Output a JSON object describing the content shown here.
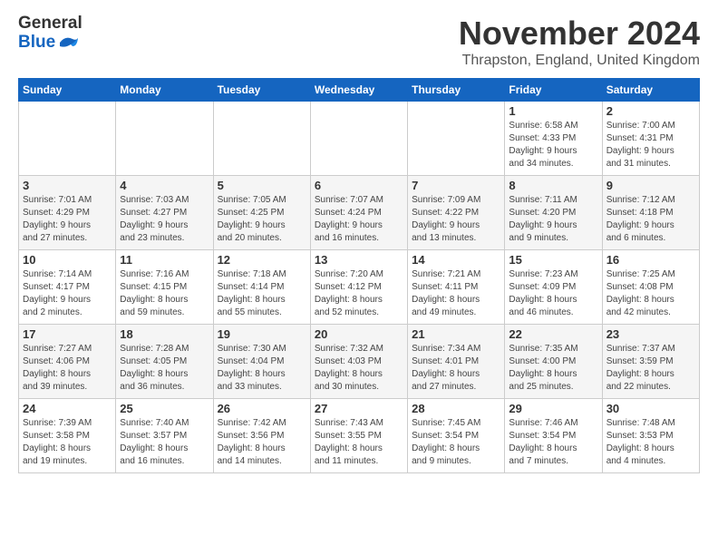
{
  "logo": {
    "line1": "General",
    "line2": "Blue"
  },
  "title": "November 2024",
  "location": "Thrapston, England, United Kingdom",
  "weekdays": [
    "Sunday",
    "Monday",
    "Tuesday",
    "Wednesday",
    "Thursday",
    "Friday",
    "Saturday"
  ],
  "weeks": [
    [
      {
        "day": "",
        "info": ""
      },
      {
        "day": "",
        "info": ""
      },
      {
        "day": "",
        "info": ""
      },
      {
        "day": "",
        "info": ""
      },
      {
        "day": "",
        "info": ""
      },
      {
        "day": "1",
        "info": "Sunrise: 6:58 AM\nSunset: 4:33 PM\nDaylight: 9 hours\nand 34 minutes."
      },
      {
        "day": "2",
        "info": "Sunrise: 7:00 AM\nSunset: 4:31 PM\nDaylight: 9 hours\nand 31 minutes."
      }
    ],
    [
      {
        "day": "3",
        "info": "Sunrise: 7:01 AM\nSunset: 4:29 PM\nDaylight: 9 hours\nand 27 minutes."
      },
      {
        "day": "4",
        "info": "Sunrise: 7:03 AM\nSunset: 4:27 PM\nDaylight: 9 hours\nand 23 minutes."
      },
      {
        "day": "5",
        "info": "Sunrise: 7:05 AM\nSunset: 4:25 PM\nDaylight: 9 hours\nand 20 minutes."
      },
      {
        "day": "6",
        "info": "Sunrise: 7:07 AM\nSunset: 4:24 PM\nDaylight: 9 hours\nand 16 minutes."
      },
      {
        "day": "7",
        "info": "Sunrise: 7:09 AM\nSunset: 4:22 PM\nDaylight: 9 hours\nand 13 minutes."
      },
      {
        "day": "8",
        "info": "Sunrise: 7:11 AM\nSunset: 4:20 PM\nDaylight: 9 hours\nand 9 minutes."
      },
      {
        "day": "9",
        "info": "Sunrise: 7:12 AM\nSunset: 4:18 PM\nDaylight: 9 hours\nand 6 minutes."
      }
    ],
    [
      {
        "day": "10",
        "info": "Sunrise: 7:14 AM\nSunset: 4:17 PM\nDaylight: 9 hours\nand 2 minutes."
      },
      {
        "day": "11",
        "info": "Sunrise: 7:16 AM\nSunset: 4:15 PM\nDaylight: 8 hours\nand 59 minutes."
      },
      {
        "day": "12",
        "info": "Sunrise: 7:18 AM\nSunset: 4:14 PM\nDaylight: 8 hours\nand 55 minutes."
      },
      {
        "day": "13",
        "info": "Sunrise: 7:20 AM\nSunset: 4:12 PM\nDaylight: 8 hours\nand 52 minutes."
      },
      {
        "day": "14",
        "info": "Sunrise: 7:21 AM\nSunset: 4:11 PM\nDaylight: 8 hours\nand 49 minutes."
      },
      {
        "day": "15",
        "info": "Sunrise: 7:23 AM\nSunset: 4:09 PM\nDaylight: 8 hours\nand 46 minutes."
      },
      {
        "day": "16",
        "info": "Sunrise: 7:25 AM\nSunset: 4:08 PM\nDaylight: 8 hours\nand 42 minutes."
      }
    ],
    [
      {
        "day": "17",
        "info": "Sunrise: 7:27 AM\nSunset: 4:06 PM\nDaylight: 8 hours\nand 39 minutes."
      },
      {
        "day": "18",
        "info": "Sunrise: 7:28 AM\nSunset: 4:05 PM\nDaylight: 8 hours\nand 36 minutes."
      },
      {
        "day": "19",
        "info": "Sunrise: 7:30 AM\nSunset: 4:04 PM\nDaylight: 8 hours\nand 33 minutes."
      },
      {
        "day": "20",
        "info": "Sunrise: 7:32 AM\nSunset: 4:03 PM\nDaylight: 8 hours\nand 30 minutes."
      },
      {
        "day": "21",
        "info": "Sunrise: 7:34 AM\nSunset: 4:01 PM\nDaylight: 8 hours\nand 27 minutes."
      },
      {
        "day": "22",
        "info": "Sunrise: 7:35 AM\nSunset: 4:00 PM\nDaylight: 8 hours\nand 25 minutes."
      },
      {
        "day": "23",
        "info": "Sunrise: 7:37 AM\nSunset: 3:59 PM\nDaylight: 8 hours\nand 22 minutes."
      }
    ],
    [
      {
        "day": "24",
        "info": "Sunrise: 7:39 AM\nSunset: 3:58 PM\nDaylight: 8 hours\nand 19 minutes."
      },
      {
        "day": "25",
        "info": "Sunrise: 7:40 AM\nSunset: 3:57 PM\nDaylight: 8 hours\nand 16 minutes."
      },
      {
        "day": "26",
        "info": "Sunrise: 7:42 AM\nSunset: 3:56 PM\nDaylight: 8 hours\nand 14 minutes."
      },
      {
        "day": "27",
        "info": "Sunrise: 7:43 AM\nSunset: 3:55 PM\nDaylight: 8 hours\nand 11 minutes."
      },
      {
        "day": "28",
        "info": "Sunrise: 7:45 AM\nSunset: 3:54 PM\nDaylight: 8 hours\nand 9 minutes."
      },
      {
        "day": "29",
        "info": "Sunrise: 7:46 AM\nSunset: 3:54 PM\nDaylight: 8 hours\nand 7 minutes."
      },
      {
        "day": "30",
        "info": "Sunrise: 7:48 AM\nSunset: 3:53 PM\nDaylight: 8 hours\nand 4 minutes."
      }
    ]
  ]
}
